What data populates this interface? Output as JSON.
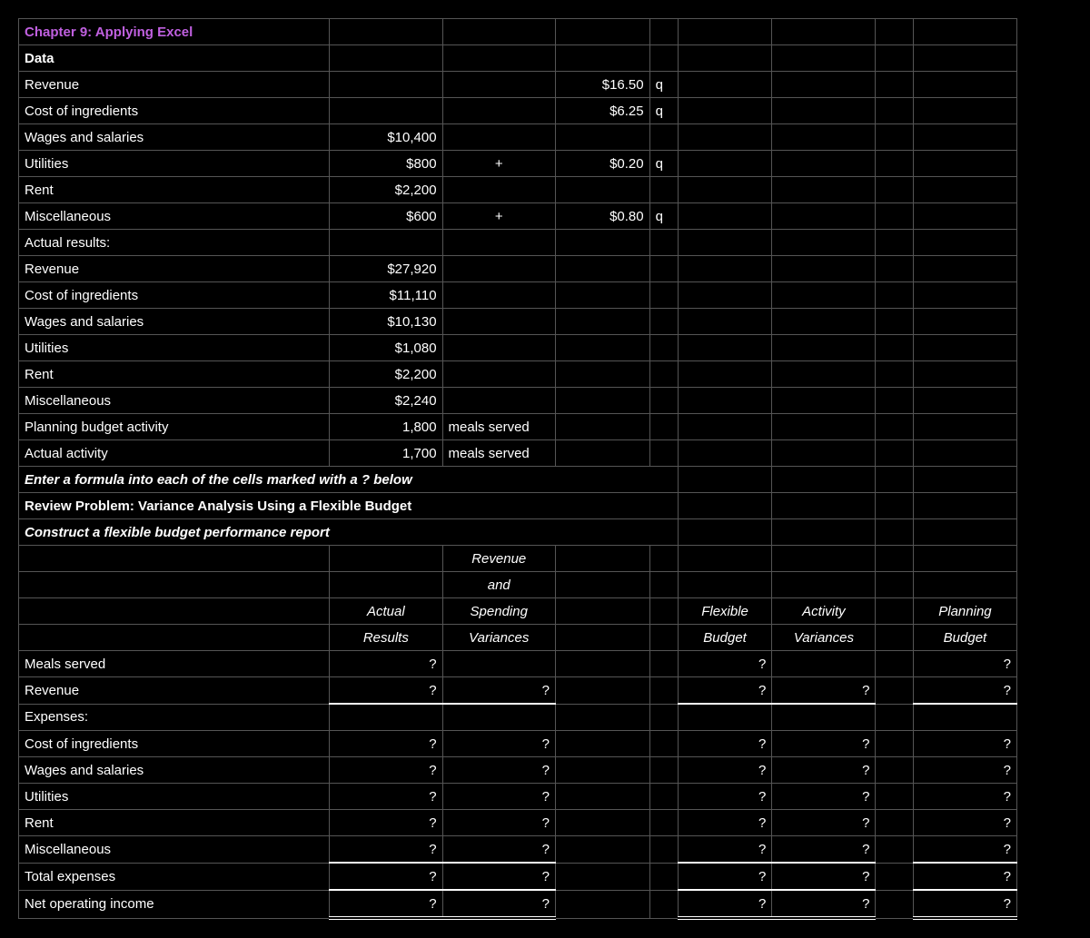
{
  "title": "Chapter 9: Applying Excel",
  "dataHeader": "Data",
  "rows": {
    "revenue": "Revenue",
    "costIng": "Cost of ingredients",
    "wages": "Wages and salaries",
    "utilities": "Utilities",
    "rent": "Rent",
    "misc": "Miscellaneous",
    "actualResults": "Actual results:",
    "planBudgetAct": "Planning budget activity",
    "actualAct": "Actual activity"
  },
  "values": {
    "revenue_rate": "$16.50",
    "costIng_rate": "$6.25",
    "wages_fixed": "$10,400",
    "utilities_fixed": "$800",
    "utilities_rate": "$0.20",
    "rent_fixed": "$2,200",
    "misc_fixed": "$600",
    "misc_rate": "$0.80",
    "actual_revenue": "$27,920",
    "actual_costIng": "$11,110",
    "actual_wages": "$10,130",
    "actual_utilities": "$1,080",
    "actual_rent": "$2,200",
    "actual_misc": "$2,240",
    "plan_activity": "1,800",
    "actual_activity": "1,700"
  },
  "units": {
    "q": "q",
    "plus": "+",
    "mealsServed": "meals served"
  },
  "instructions": {
    "line1": "Enter a formula into each of the cells marked with a ? below",
    "line2": "Review Problem: Variance Analysis Using a Flexible Budget",
    "line3": "Construct a flexible budget performance report"
  },
  "headers": {
    "rev1": "Revenue",
    "rev2": "and",
    "rev3": "Spending",
    "rev4": "Variances",
    "actual1": "Actual",
    "actual2": "Results",
    "flex1": "Flexible",
    "flex2": "Budget",
    "actv1": "Activity",
    "actv2": "Variances",
    "plan1": "Planning",
    "plan2": "Budget"
  },
  "reportRows": {
    "mealsServed": "Meals served",
    "revenue": "Revenue",
    "expensesHdr": "Expenses:",
    "costIng": "Cost of ingredients",
    "wages": "Wages and salaries",
    "utilities": "Utilities",
    "rent": "Rent",
    "misc": "Miscellaneous",
    "totalExp": "Total expenses",
    "netOpInc": "Net operating income"
  },
  "qmark": "?"
}
